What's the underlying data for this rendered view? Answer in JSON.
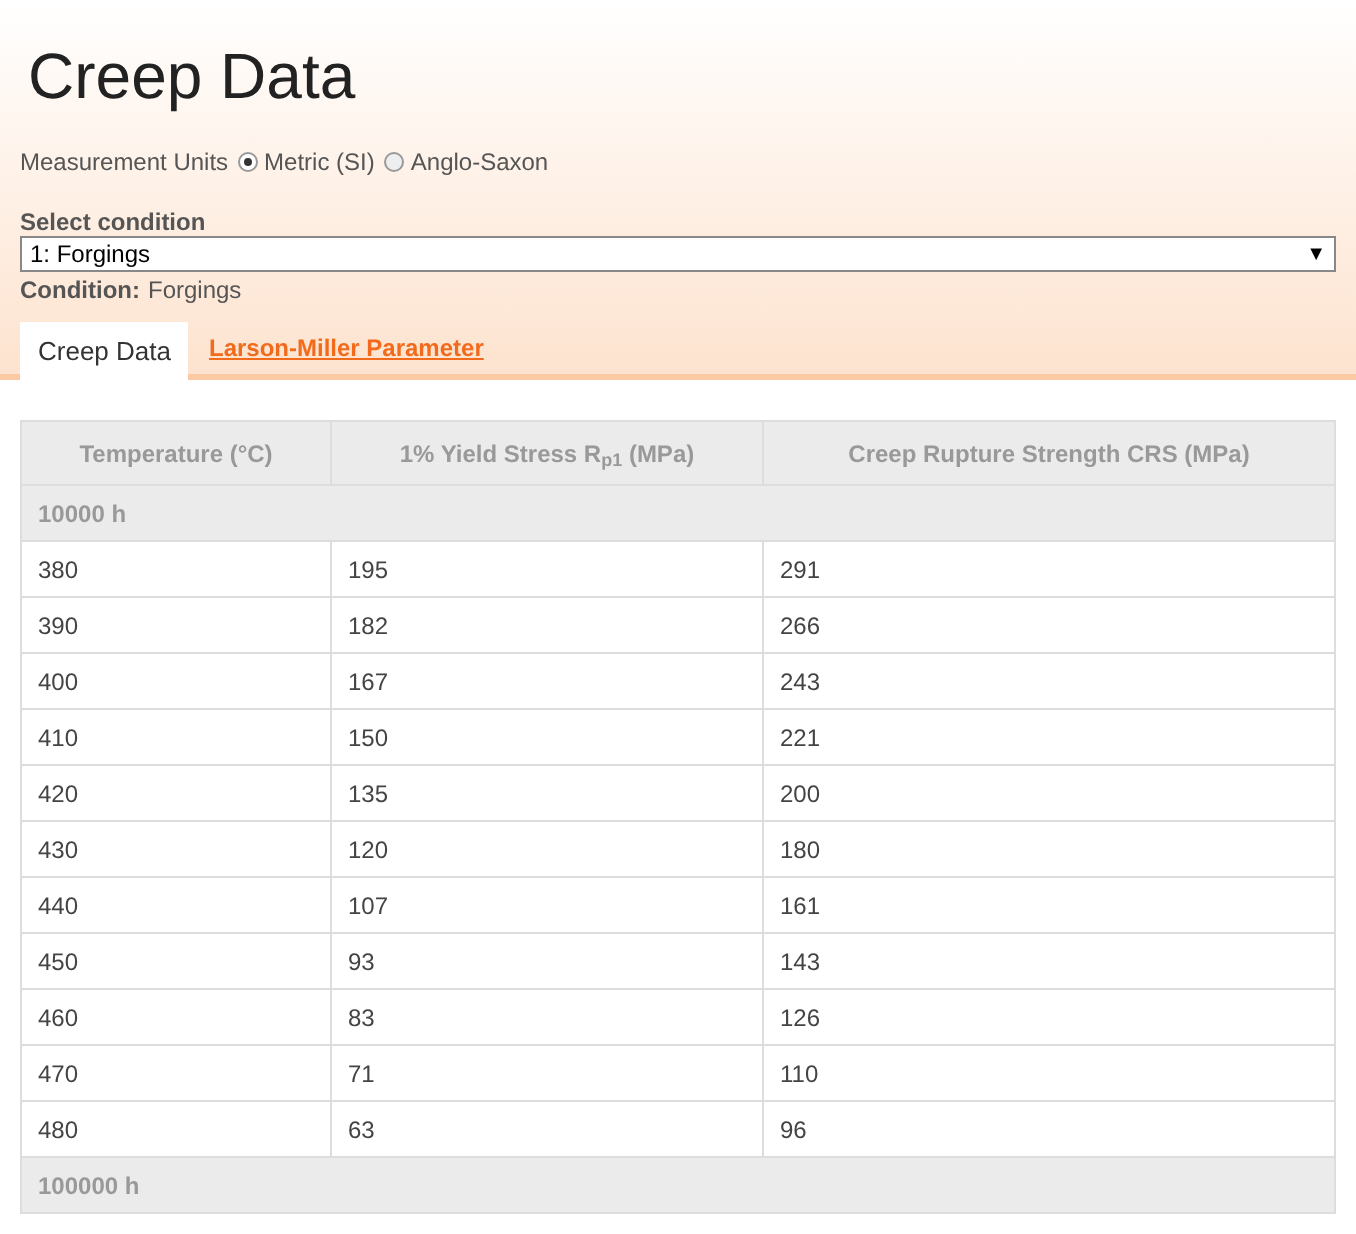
{
  "title": "Creep Data",
  "units": {
    "label": "Measurement Units",
    "options": [
      {
        "label": "Metric (SI)",
        "selected": true
      },
      {
        "label": "Anglo-Saxon",
        "selected": false
      }
    ]
  },
  "condition_select": {
    "label": "Select condition",
    "value": "1: Forgings",
    "arrow": "▼"
  },
  "condition": {
    "label": "Condition:",
    "value": "Forgings"
  },
  "tabs": [
    {
      "label": "Creep Data",
      "selected": true
    },
    {
      "label": "Larson-Miller Parameter",
      "selected": false
    }
  ],
  "table": {
    "columns": [
      "Temperature (°C)",
      "1% Yield Stress R$_{p1}$ (MPa)",
      "Creep Rupture Strength CRS (MPa)"
    ],
    "groups": [
      {
        "label": "10000 h",
        "rows": [
          [
            "380",
            "195",
            "291"
          ],
          [
            "390",
            "182",
            "266"
          ],
          [
            "400",
            "167",
            "243"
          ],
          [
            "410",
            "150",
            "221"
          ],
          [
            "420",
            "135",
            "200"
          ],
          [
            "430",
            "120",
            "180"
          ],
          [
            "440",
            "107",
            "161"
          ],
          [
            "450",
            "93",
            "143"
          ],
          [
            "460",
            "83",
            "126"
          ],
          [
            "470",
            "71",
            "110"
          ],
          [
            "480",
            "63",
            "96"
          ]
        ]
      },
      {
        "label": "100000 h"
      }
    ]
  }
}
